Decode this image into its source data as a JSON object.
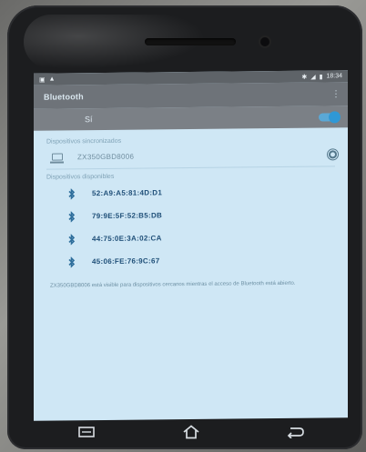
{
  "statusbar": {
    "time": "18:34"
  },
  "appbar": {
    "title": "Bluetooth"
  },
  "toggle": {
    "label": "Sí"
  },
  "paired_section": {
    "header": "Dispositivos sincronizados",
    "devices": [
      {
        "name": "ZX350GBD8006"
      }
    ]
  },
  "available_section": {
    "header": "Dispositivos disponibles",
    "devices": [
      {
        "address": "52:A9:A5:81:4D:D1"
      },
      {
        "address": "79:9E:5F:52:B5:DB"
      },
      {
        "address": "44:75:0E:3A:02:CA"
      },
      {
        "address": "45:06:FE:76:9C:67"
      }
    ]
  },
  "footer": {
    "text": "ZX350GBD8006 está visible para dispositivos cercanos mientras el acceso de Bluetooth está abierto."
  },
  "colors": {
    "screen_bg": "#cfe7f5",
    "appbar": "#6e7379",
    "accent": "#2f98d6",
    "address_text": "#1f4f78"
  }
}
